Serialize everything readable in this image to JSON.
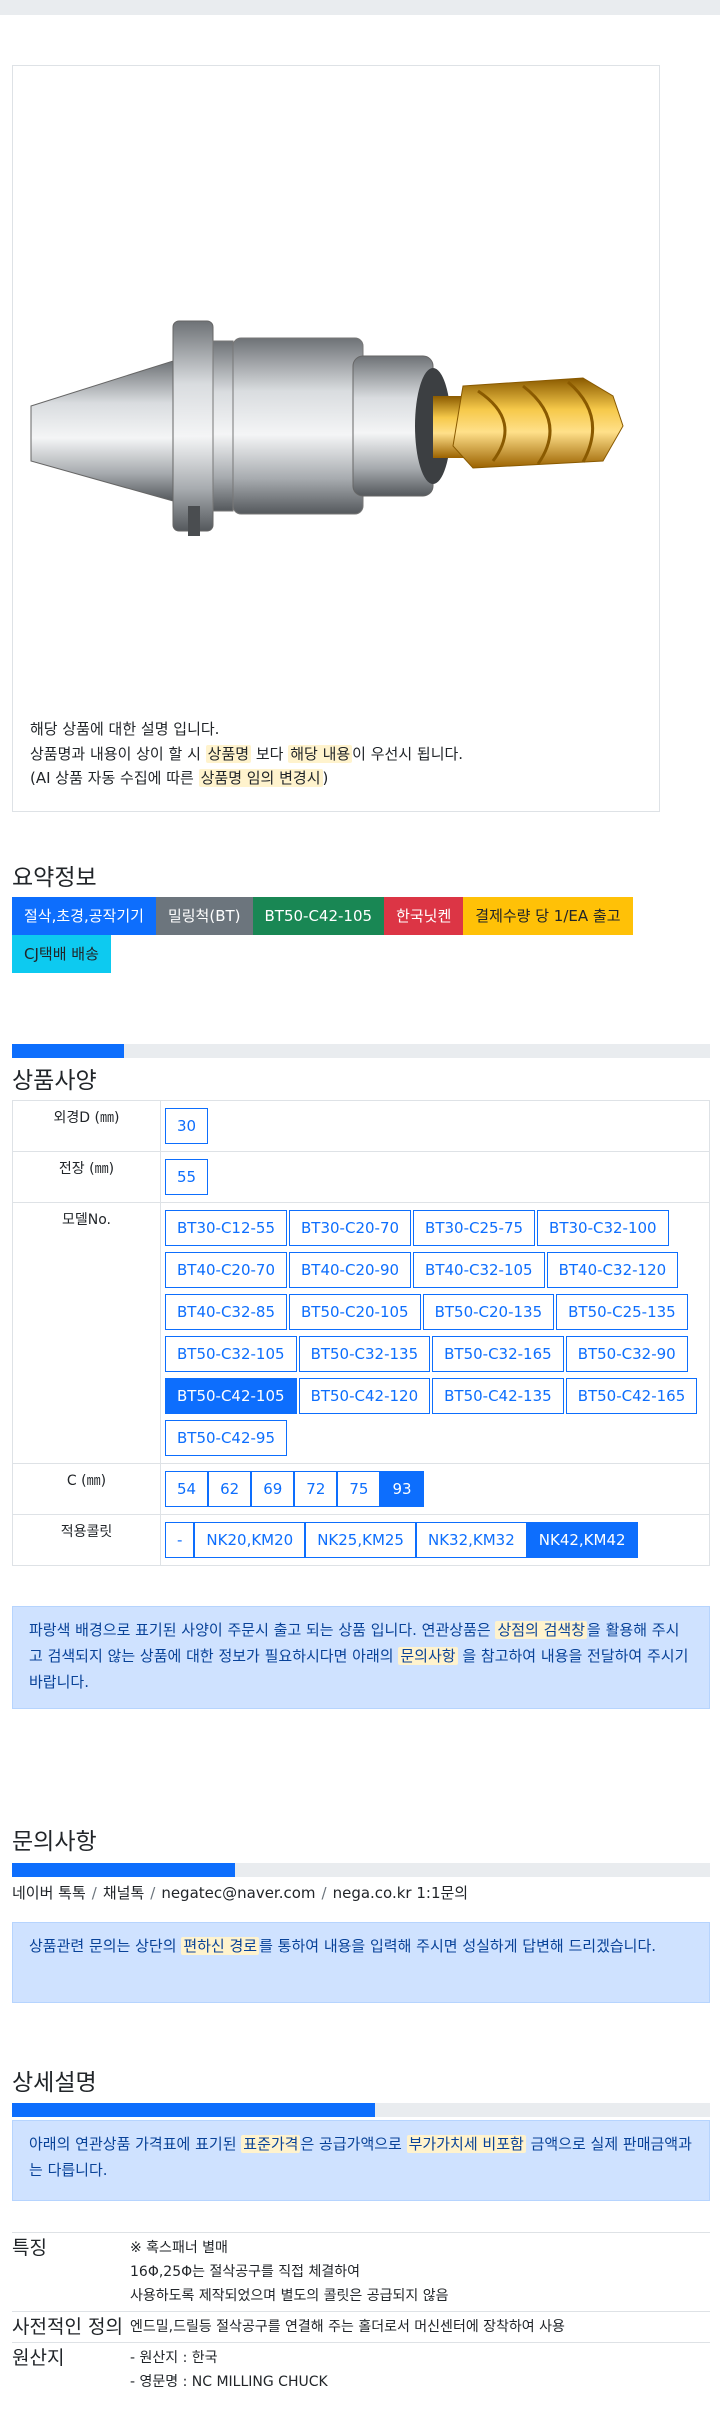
{
  "product": {
    "desc_line1": "해당 상품에 대한 설명 입니다.",
    "desc_line2_a": "상품명과 내용이 상이 할 시 ",
    "desc_line2_hl1": "상품명",
    "desc_line2_b": " 보다 ",
    "desc_line2_hl2": "해당 내용",
    "desc_line2_c": "이 우선시 됩니다.",
    "desc_line3_a": "(AI 상품 자동 수집에 따른 ",
    "desc_line3_hl": "상품명 임의 변경시",
    "desc_line3_b": ")"
  },
  "summary": {
    "title": "요약정보",
    "badges": [
      "절삭,초경,공작기기",
      "밀링척(BT)",
      "BT50-C42-105",
      "한국닛켄",
      "결제수량 당 1/EA 출고",
      "CJ택배 배송"
    ],
    "badge_colors": [
      "#0d6efd",
      "#6c757d",
      "#198754",
      "#dc3545",
      "#ffc107",
      "#0dcaf0"
    ]
  },
  "spec": {
    "title": "상품사양",
    "progress_percent": 16,
    "rows": [
      {
        "label": "외경D (㎜)",
        "options": [
          "30"
        ],
        "selected": -1
      },
      {
        "label": "전장 (㎜)",
        "options": [
          "55"
        ],
        "selected": -1
      },
      {
        "label": "모델No.",
        "options": [
          "BT30-C12-55",
          "BT30-C20-70",
          "BT30-C25-75",
          "BT30-C32-100",
          "BT40-C20-70",
          "BT40-C20-90",
          "BT40-C32-105",
          "BT40-C32-120",
          "BT40-C32-85",
          "BT50-C20-105",
          "BT50-C20-135",
          "BT50-C25-135",
          "BT50-C32-105",
          "BT50-C32-135",
          "BT50-C32-165",
          "BT50-C32-90",
          "BT50-C42-105",
          "BT50-C42-120",
          "BT50-C42-135",
          "BT50-C42-165",
          "BT50-C42-95"
        ],
        "selected": 16
      },
      {
        "label": "C (㎜)",
        "options": [
          "54",
          "62",
          "69",
          "72",
          "75",
          "93"
        ],
        "selected": 5
      },
      {
        "label": "적용콜릿",
        "options": [
          "-",
          "NK20,KM20",
          "NK25,KM25",
          "NK32,KM32",
          "NK42,KM42"
        ],
        "selected": 4
      }
    ],
    "notice_a": "파랑색 배경으로 표기된 사양이 주문시 출고 되는 상품 입니다. 연관상품은 ",
    "notice_hl1": "상점의 검색창",
    "notice_b": "을 활용해 주시고 검색되지 않는 상품에 대한 정보가 필요하시다면 아래의 ",
    "notice_hl2": "문의사항",
    "notice_c": " 을 참고하여 내용을 전달하여 주시기 바랍니다."
  },
  "inquiry": {
    "title": "문의사항",
    "progress_percent": 32,
    "contacts": [
      "네이버 톡톡",
      "채널톡",
      "negatec@naver.com",
      "nega.co.kr 1:1문의"
    ],
    "notice_a": "상품관련 문의는 상단의 ",
    "notice_hl": "편하신 경로",
    "notice_b": "를 통하여 내용을 입력해 주시면 성실하게 답변해 드리겠습니다."
  },
  "detail": {
    "title": "상세설명",
    "progress_percent": 52,
    "notice_a": "아래의 연관상품 가격표에 표기된 ",
    "notice_hl1": "표준가격",
    "notice_b": "은 공급가액으로 ",
    "notice_hl2": "부가가치세 비포함",
    "notice_c": " 금액으로 실제 판매금액과는 다릅니다.",
    "rows": [
      {
        "key": "특징",
        "lines": [
          "※ 혹스패너 별매",
          "16Φ,25Φ는 절삭공구를 직접 체결하여",
          "사용하도록 제작되었으며 별도의 콜릿은 공급되지 않음"
        ]
      },
      {
        "key": "사전적인 정의",
        "lines": [
          "엔드밀,드릴등 절삭공구를 연결해 주는 홀더로서 머신센터에 장착하여 사용"
        ]
      },
      {
        "key": "원산지",
        "lines": [
          "- 원산지 : 한국",
          "- 영문명 : NC MILLING CHUCK"
        ]
      }
    ]
  }
}
